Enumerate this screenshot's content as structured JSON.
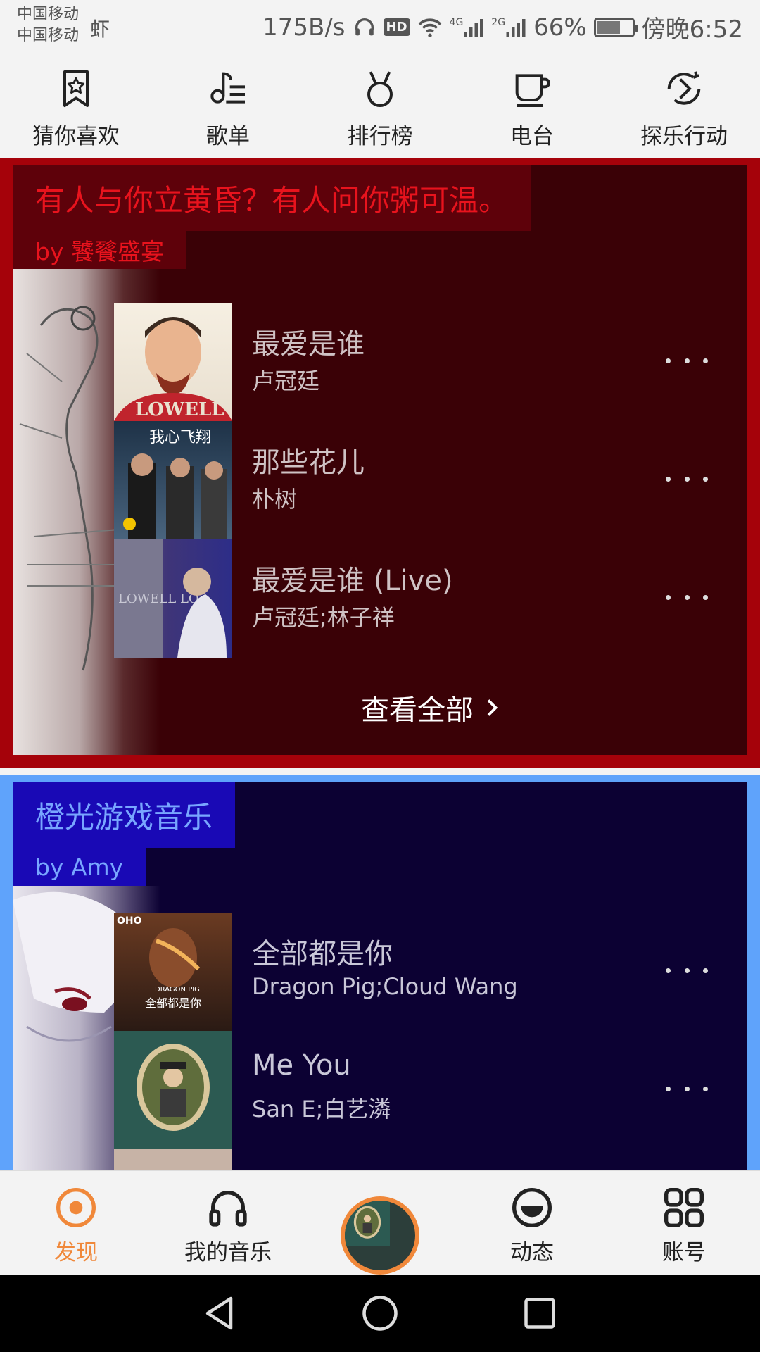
{
  "status_bar": {
    "carrier1": "中国移动",
    "carrier2": "中国移动",
    "carrier_extra": "虾",
    "net_speed": "175B/s",
    "hd": "HD",
    "net_4g": "4G",
    "net_2g": "2G",
    "battery": "66%",
    "battery_level": 0.66,
    "time": "傍晚6:52"
  },
  "category_nav": [
    {
      "label": "猜你喜欢",
      "icon": "bookmark-star-icon"
    },
    {
      "label": "歌单",
      "icon": "music-list-icon"
    },
    {
      "label": "排行榜",
      "icon": "medal-icon"
    },
    {
      "label": "电台",
      "icon": "cup-icon"
    },
    {
      "label": "探乐行动",
      "icon": "explore-icon"
    }
  ],
  "playlists": [
    {
      "title": "有人与你立黄昏？有人问你粥可温。",
      "by": "by 饕餮盛宴",
      "colors": {
        "outer": "#a5020a",
        "inner": "#3a0106",
        "title_bg": "#5e010a",
        "accent": "#e8131d",
        "text": "#cfc2c4"
      },
      "songs": [
        {
          "title": "最爱是谁",
          "artist": "卢冠廷"
        },
        {
          "title": "那些花儿",
          "artist": "朴树"
        },
        {
          "title": "最爱是谁 (Live)",
          "artist": "卢冠廷;林子祥"
        }
      ],
      "view_all": "查看全部"
    },
    {
      "title": "橙光游戏音乐",
      "by": "by Amy",
      "colors": {
        "outer": "#5fa3fb",
        "inner": "#0c0133",
        "title_bg": "#1909b5",
        "accent": "#78a6ff",
        "text": "#c9c7d8"
      },
      "songs": [
        {
          "title": "全部都是你",
          "artist": "Dragon Pig;Cloud Wang"
        },
        {
          "title": "Me You",
          "artist": "San E;白艺潾"
        }
      ]
    }
  ],
  "tab_bar": [
    {
      "label": "发现",
      "icon": "discover-icon",
      "active": true
    },
    {
      "label": "我的音乐",
      "icon": "headphones-icon",
      "active": false
    },
    {
      "label": "",
      "icon": "now-playing-disc",
      "active": false
    },
    {
      "label": "动态",
      "icon": "smile-icon",
      "active": false
    },
    {
      "label": "账号",
      "icon": "grid-icon",
      "active": false
    }
  ],
  "accent_color": "#f0883a"
}
